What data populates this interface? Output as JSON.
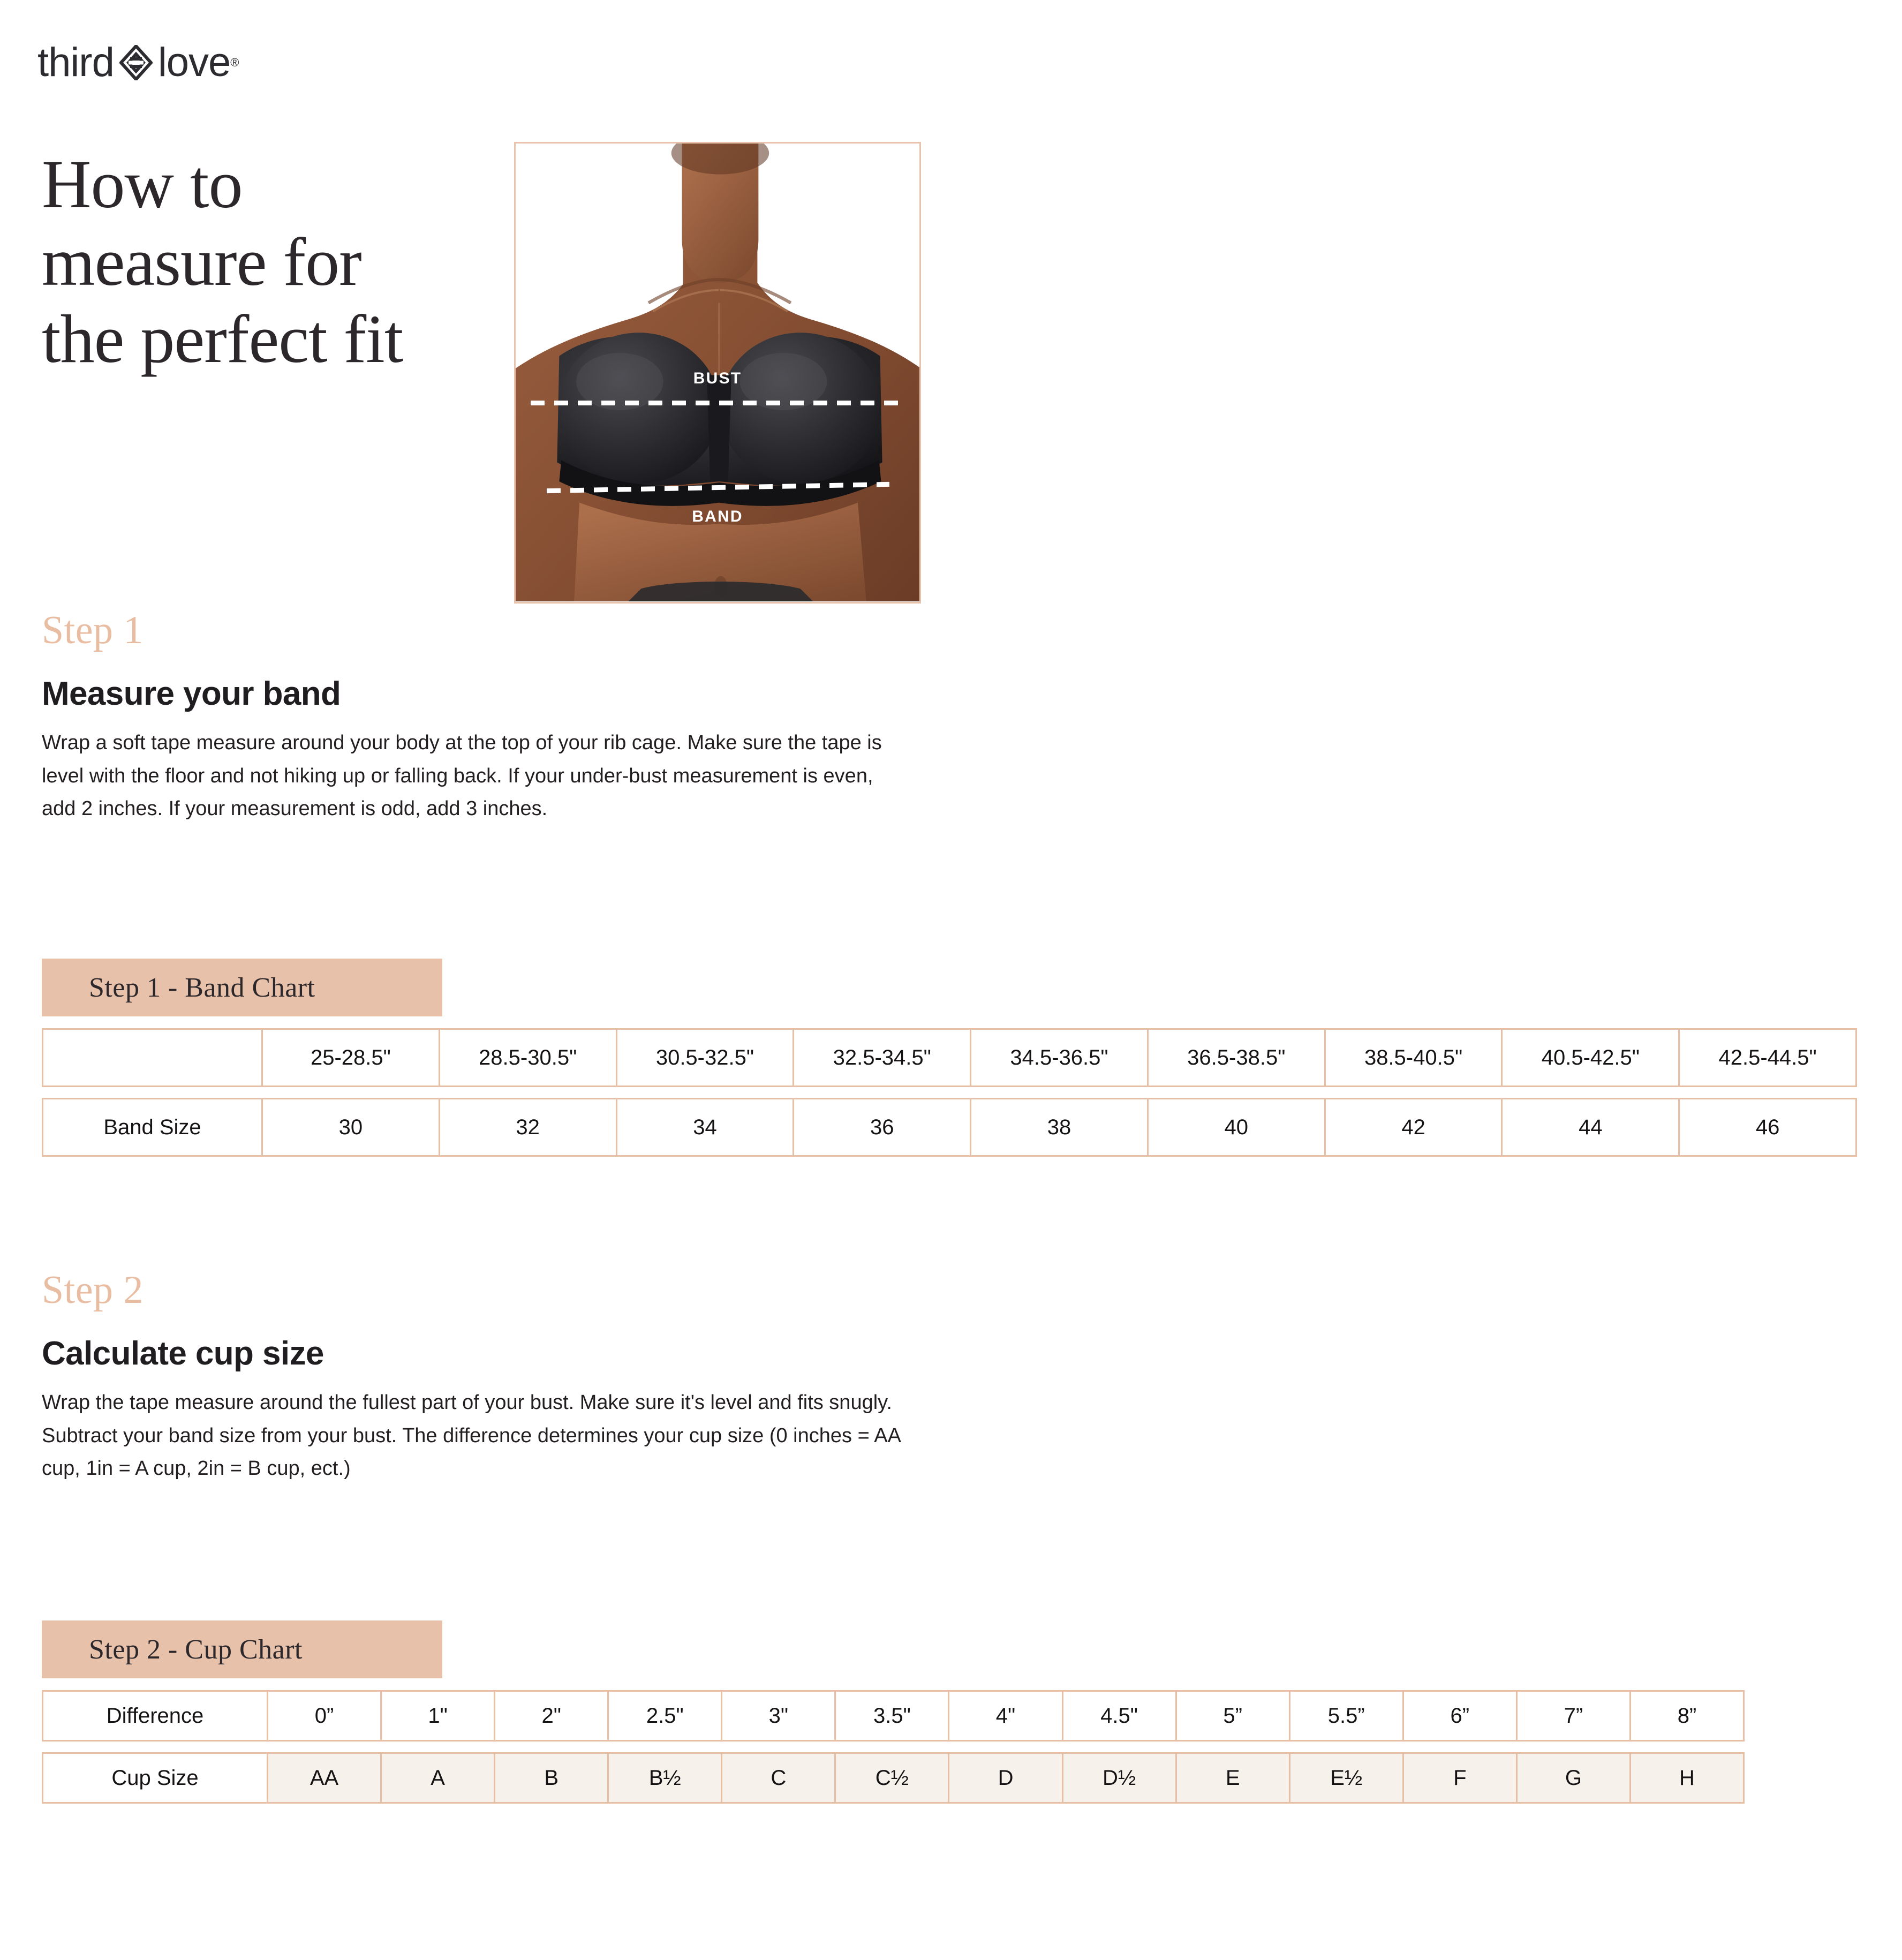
{
  "brand": {
    "name_part1": "third",
    "name_part2": "love",
    "registered": "®",
    "logo_icon": "thirdlove-diamond-logo"
  },
  "headline": "How to measure for the perfect fit",
  "photo": {
    "alt_name": "model-wearing-black-strapless-bra",
    "label_bust": "BUST",
    "label_band": "BAND"
  },
  "colors": {
    "accent_peach": "#e8c1aa",
    "border_peach": "#e7bfa5",
    "kicker_peach": "#e8bda2",
    "cell_shaded": "#f7f1ec",
    "text_dark": "#1f1d1f"
  },
  "steps": [
    {
      "kicker": "Step 1",
      "heading": "Measure your band",
      "body": "Wrap a soft tape measure around your body at the top of your rib cage. Make sure the tape is level with the floor and not hiking up or falling back. If your under-bust measurement is even, add 2 inches. If your measurement is odd, add 3 inches."
    },
    {
      "kicker": "Step 2",
      "heading": "Calculate cup size",
      "body": "Wrap the tape measure around the fullest part of your bust. Make sure it's level and fits snugly. Subtract your band size from your bust. The difference determines your cup size (0 inches = AA cup, 1in = A cup, 2in = B cup, ect.)"
    }
  ],
  "chart_data": [
    {
      "type": "table",
      "title": "Step 1  -  Band Chart",
      "row_label_measurement": "",
      "row_label_size": "Band Size",
      "measurements": [
        "25-28.5\"",
        "28.5-30.5\"",
        "30.5-32.5\"",
        "32.5-34.5\"",
        "34.5-36.5\"",
        "36.5-38.5\"",
        "38.5-40.5\"",
        "40.5-42.5\"",
        "42.5-44.5\""
      ],
      "band_sizes": [
        "30",
        "32",
        "34",
        "36",
        "38",
        "40",
        "42",
        "44",
        "46"
      ]
    },
    {
      "type": "table",
      "title": "Step 2  -  Cup Chart",
      "row_label_difference": "Difference",
      "row_label_cup": "Cup Size",
      "differences": [
        "0”",
        "1\"",
        "2\"",
        "2.5\"",
        "3\"",
        "3.5\"",
        "4\"",
        "4.5\"",
        "5”",
        "5.5”",
        "6”",
        "7”",
        "8”"
      ],
      "cup_sizes": [
        "AA",
        "A",
        "B",
        "B½",
        "C",
        "C½",
        "D",
        "D½",
        "E",
        "E½",
        "F",
        "G",
        "H"
      ]
    }
  ]
}
